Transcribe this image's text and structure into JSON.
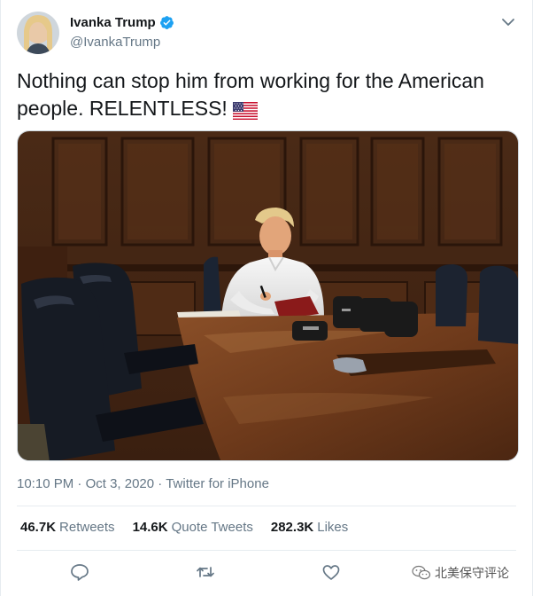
{
  "author": {
    "display_name": "Ivanka Trump",
    "handle": "@IvankaTrump",
    "verified": true
  },
  "tweet": {
    "text": "Nothing can stop him from working for the American people. RELENTLESS!",
    "emoji": "us-flag"
  },
  "meta": {
    "time": "10:10 PM",
    "separator": "·",
    "date": "Oct 3, 2020",
    "source": "Twitter for iPhone"
  },
  "stats": {
    "retweets_count": "46.7K",
    "retweets_label": "Retweets",
    "quotes_count": "14.6K",
    "quotes_label": "Quote Tweets",
    "likes_count": "282.3K",
    "likes_label": "Likes"
  },
  "actions": [
    "reply-icon",
    "retweet-icon",
    "like-icon"
  ],
  "watermark": {
    "text": "北美保守评论"
  },
  "colors": {
    "verified_blue": "#1da1f2",
    "secondary_text": "#657786",
    "primary_text": "#14171a",
    "divider": "#e6ecf0"
  }
}
